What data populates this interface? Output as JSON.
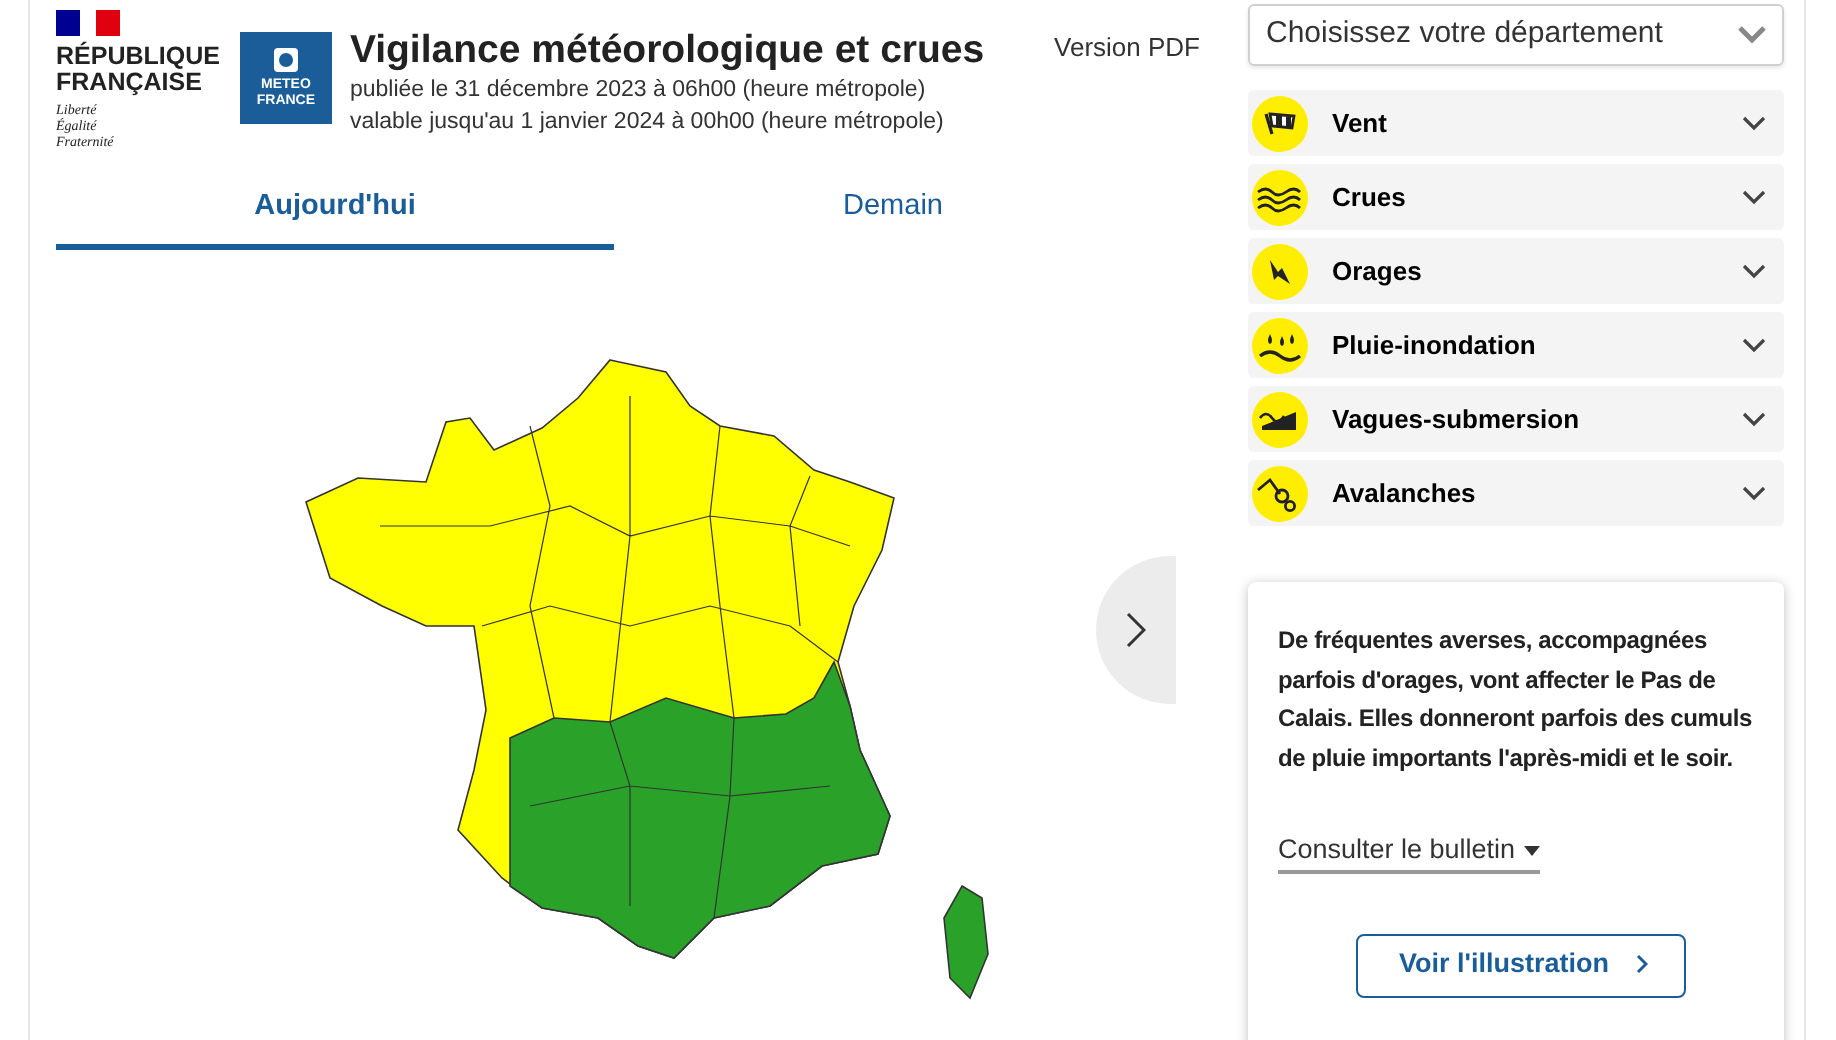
{
  "header": {
    "marianne": {
      "name_lines": [
        "RÉPUBLIQUE",
        "FRANÇAISE"
      ],
      "motto": [
        "Liberté",
        "Égalité",
        "Fraternité"
      ]
    },
    "partner_logo": {
      "lines": [
        "METEO",
        "FRANCE"
      ]
    },
    "title": "Vigilance météorologique et crues",
    "published": "publiée le 31 décembre 2023 à 06h00 (heure métropole)",
    "valid_until": "valable jusqu'au 1 janvier 2024 à 00h00 (heure métropole)"
  },
  "pdf_link": "Version PDF",
  "tabs": [
    {
      "label": "Aujourd'hui",
      "selected": true
    },
    {
      "label": "Demain",
      "selected": false
    }
  ],
  "department_select": {
    "placeholder": "Choisissez votre département"
  },
  "phenomena": [
    {
      "kind": "wind",
      "label": "Vent",
      "expanded": false
    },
    {
      "kind": "flood",
      "label": "Crues",
      "expanded": false
    },
    {
      "kind": "storm",
      "label": "Orages",
      "expanded": false
    },
    {
      "kind": "rain",
      "label": "Pluie-inondation",
      "expanded": false
    },
    {
      "kind": "waves",
      "label": "Vagues-submersion",
      "expanded": false
    },
    {
      "kind": "avalanche",
      "label": "Avalanches",
      "expanded": false
    }
  ],
  "bulletin": {
    "text": "De fréquentes averses, accompagnées parfois d'orages, vont affecter le Pas de Calais. Elles donneront parfois des cumuls de pluie importants l'après-midi et le soir.",
    "link": "Consulter le bulletin",
    "button": "Voir l'illustration"
  }
}
